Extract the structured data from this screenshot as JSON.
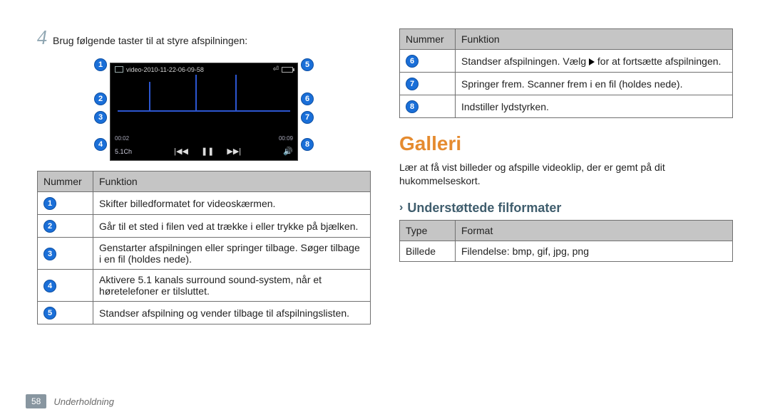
{
  "step": {
    "number": "4",
    "text": "Brug følgende taster til at styre afspilningen:"
  },
  "video": {
    "filename": "video-2010-11-22-06-09-58",
    "time_elapsed": "00:02",
    "time_total": "00:09",
    "surround": "5.1Ch",
    "callouts": [
      "1",
      "2",
      "3",
      "4",
      "5",
      "6",
      "7",
      "8"
    ]
  },
  "table1": {
    "head_num": "Nummer",
    "head_func": "Funktion",
    "rows": [
      {
        "n": "1",
        "f": "Skifter billedformatet for videoskærmen."
      },
      {
        "n": "2",
        "f": "Går til et sted i filen ved at trække i eller trykke på bjælken."
      },
      {
        "n": "3",
        "f": "Genstarter afspilningen eller springer tilbage. Søger tilbage i en fil (holdes nede)."
      },
      {
        "n": "4",
        "f": "Aktivere 5.1 kanals surround sound-system, når et høretelefoner er tilsluttet."
      },
      {
        "n": "5",
        "f": "Standser afspilning og vender tilbage til afspilningslisten."
      }
    ]
  },
  "table2": {
    "head_num": "Nummer",
    "head_func": "Funktion",
    "rows": [
      {
        "n": "6",
        "f_pre": "Standser afspilningen. Vælg ",
        "f_post": " for at fortsætte afspilningen."
      },
      {
        "n": "7",
        "f": "Springer frem. Scanner frem i en fil (holdes nede)."
      },
      {
        "n": "8",
        "f": "Indstiller lydstyrken."
      }
    ]
  },
  "gallery": {
    "title": "Galleri",
    "lead": "Lær at få vist billeder og afspille videoklip, der er gemt på dit hukommelseskort.",
    "sub": "Understøttede filformater",
    "fmt_head_type": "Type",
    "fmt_head_format": "Format",
    "fmt_row_type": "Billede",
    "fmt_row_format": "Filendelse: bmp, gif, jpg, png"
  },
  "footer": {
    "page": "58",
    "section": "Underholdning"
  }
}
